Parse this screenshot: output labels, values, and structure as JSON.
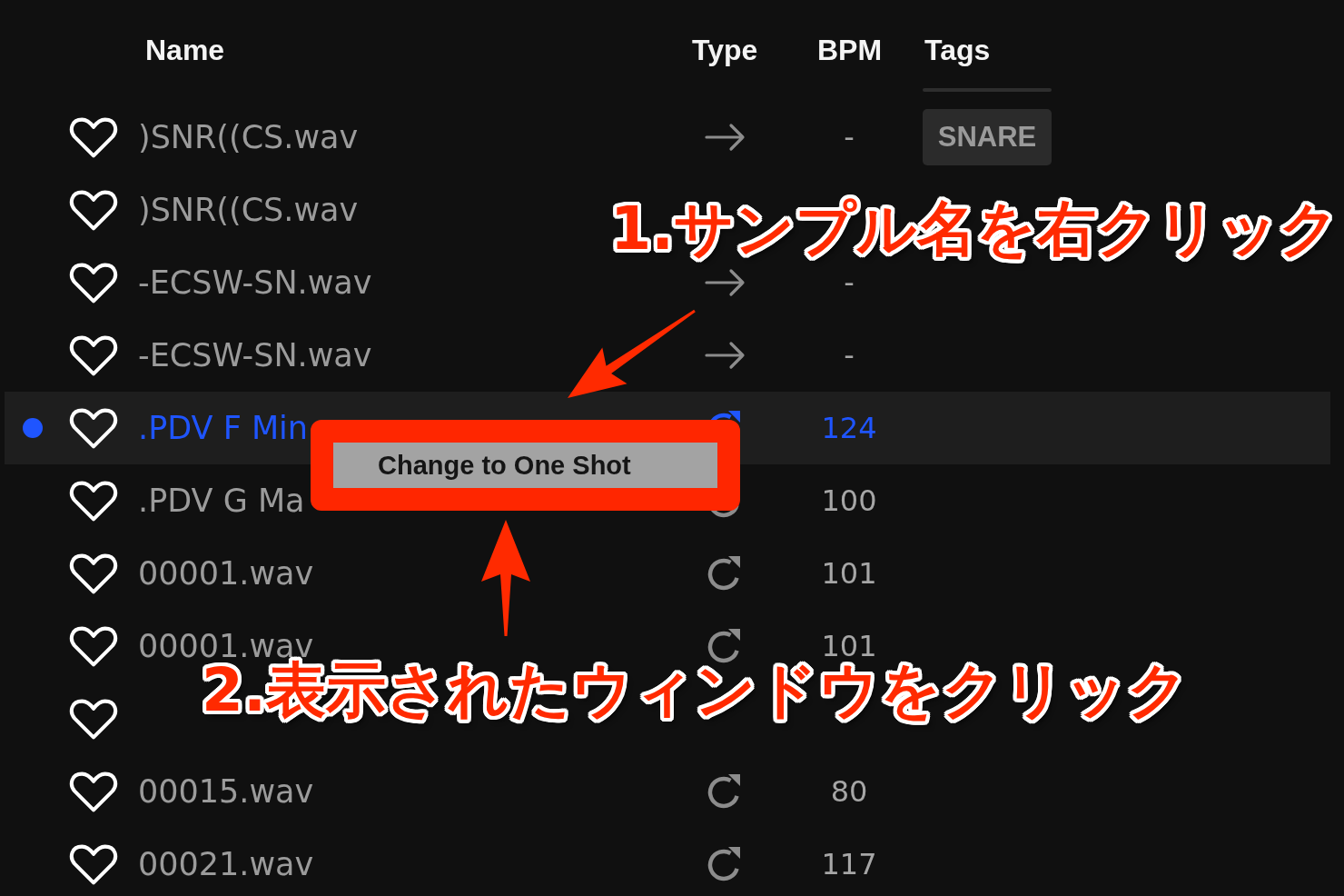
{
  "columns": [
    "Name",
    "Type",
    "BPM",
    "Tags"
  ],
  "rows": [
    {
      "name": ")SNR((CS.wav",
      "favorite": false,
      "kind": "one_shot",
      "bpm": "-",
      "tags": [
        "SNARE"
      ],
      "selected": false
    },
    {
      "name": ")SNR((CS.wav",
      "favorite": false,
      "selected": false
    },
    {
      "name": "-ECSW-SN.wav",
      "favorite": false,
      "kind": "one_shot",
      "bpm": "-",
      "selected": false
    },
    {
      "name": "-ECSW-SN.wav",
      "favorite": false,
      "kind": "one_shot",
      "bpm": "-",
      "selected": false
    },
    {
      "name": ".PDV F Min",
      "favorite": false,
      "kind": "loop",
      "bpm": "124",
      "selected": true
    },
    {
      "name": ".PDV G Ma",
      "favorite": false,
      "kind": "loop",
      "bpm": "100",
      "selected": false
    },
    {
      "name": "00001.wav",
      "favorite": false,
      "kind": "loop",
      "bpm": "101",
      "selected": false
    },
    {
      "name": "00001.wav",
      "favorite": false,
      "kind": "loop",
      "bpm": "101",
      "selected": false
    },
    {
      "favorite": false,
      "selected": false
    },
    {
      "name": "00015.wav",
      "favorite": false,
      "kind": "loop",
      "bpm": "80",
      "selected": false
    },
    {
      "name": "00021.wav",
      "favorite": false,
      "kind": "loop",
      "bpm": "117",
      "selected": false
    }
  ],
  "context_menu": {
    "items": [
      {
        "label": "Change to One Shot",
        "highlighted": true
      }
    ]
  },
  "callouts": [
    {
      "text": "1.サンプル名を右クリック"
    },
    {
      "text": "2.表示されたウィンドウをクリック"
    }
  ]
}
